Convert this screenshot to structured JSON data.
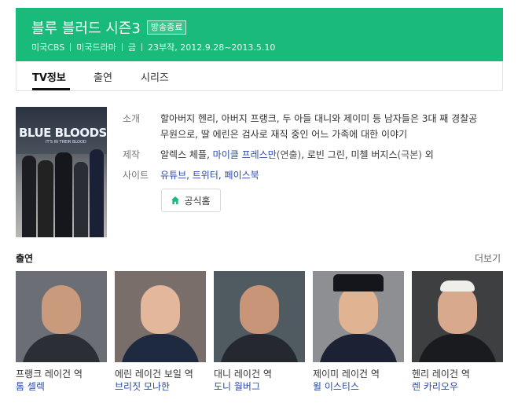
{
  "header": {
    "title": "블루 블러드 시즌3",
    "badge": "방송종료",
    "meta": [
      "미국CBS",
      "미국드라마",
      "금",
      "23부작, 2012.9.28~2013.5.10"
    ],
    "bg_color": "#19ba7a"
  },
  "tabs": [
    {
      "label": "TV정보",
      "active": true
    },
    {
      "label": "출연",
      "active": false
    },
    {
      "label": "시리즈",
      "active": false
    }
  ],
  "poster": {
    "title_text": "BLUE BLOODS",
    "sub_text": "IT'S IN THEIR BLOOD"
  },
  "info": {
    "intro_label": "소개",
    "intro_text": "할아버지 헨리, 아버지 프랭크, 두 아들 대니와 제이미 등 남자들은 3대 째 경찰공무원으로, 딸 에린은 검사로 재직 중인 어느 가족에 대한 이야기",
    "production_label": "제작",
    "production_name1": "알렉스 체플",
    "production_name2": "마이클 프레스만",
    "production_role2": "(연출)",
    "production_name3": "로빈 그린",
    "production_name4": "미첼 버지스",
    "production_role4": "(극본)",
    "production_suffix": "외",
    "site_label": "사이트",
    "sites": [
      "유튜브",
      "트위터",
      "페이스북"
    ],
    "home_button": "공식홈",
    "home_icon": "home-icon"
  },
  "cast": {
    "title": "출연",
    "more": "더보기",
    "members": [
      {
        "role": "프랭크 레이건 역",
        "actor": "톰 셀렉"
      },
      {
        "role": "에린 레이건 보일 역",
        "actor": "브리짓 모나한"
      },
      {
        "role": "대니 레이건 역",
        "actor": "도니 월버그"
      },
      {
        "role": "제이미 레이건 역",
        "actor": "윌 이스티스"
      },
      {
        "role": "헨리 레이건 역",
        "actor": "렌 카리오우"
      }
    ]
  }
}
